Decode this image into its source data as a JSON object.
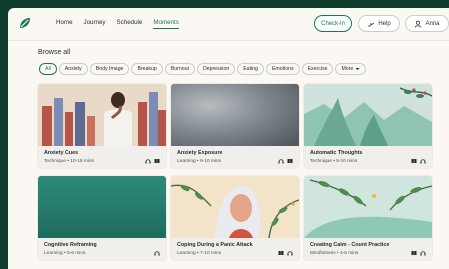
{
  "nav": {
    "links": [
      {
        "label": "Home",
        "active": false
      },
      {
        "label": "Journey",
        "active": false
      },
      {
        "label": "Schedule",
        "active": false
      },
      {
        "label": "Moments",
        "active": true
      }
    ],
    "checkin_label": "Check-in",
    "help_label": "Help",
    "user_label": "Anna"
  },
  "browse_title": "Browse all",
  "chips": [
    "All",
    "Anxiety",
    "Body Image",
    "Breakup",
    "Burnout",
    "Depression",
    "Eating",
    "Emotions",
    "Exercise",
    "More"
  ],
  "cards": [
    {
      "title": "Anxiety Cues",
      "meta": "Technique • 10-15 mins",
      "icons": [
        "headphones-icon",
        "book-icon"
      ]
    },
    {
      "title": "Anxiety Exposure",
      "meta": "Learning • 9-10 mins",
      "icons": [
        "headphones-icon",
        "book-icon"
      ]
    },
    {
      "title": "Automatic Thoughts",
      "meta": "Technique • 5-10 mins",
      "icons": [
        "book-icon",
        "headphones-icon"
      ]
    },
    {
      "title": "Cognitive Reframing",
      "meta": "Learning • 5-6 mins",
      "icons": [
        "headphones-icon"
      ]
    },
    {
      "title": "Coping During a Panic Attack",
      "meta": "Learning • 7-10 mins",
      "icons": [
        "book-icon",
        "headphones-icon"
      ]
    },
    {
      "title": "Creating Calm - Count Practice",
      "meta": "Mindfulness • 4-5 mins",
      "icons": [
        "book-icon",
        "headphones-icon"
      ]
    }
  ],
  "colors": {
    "brand": "#157a54",
    "background": "#0f3d2e",
    "surface": "#fbf8f4"
  }
}
